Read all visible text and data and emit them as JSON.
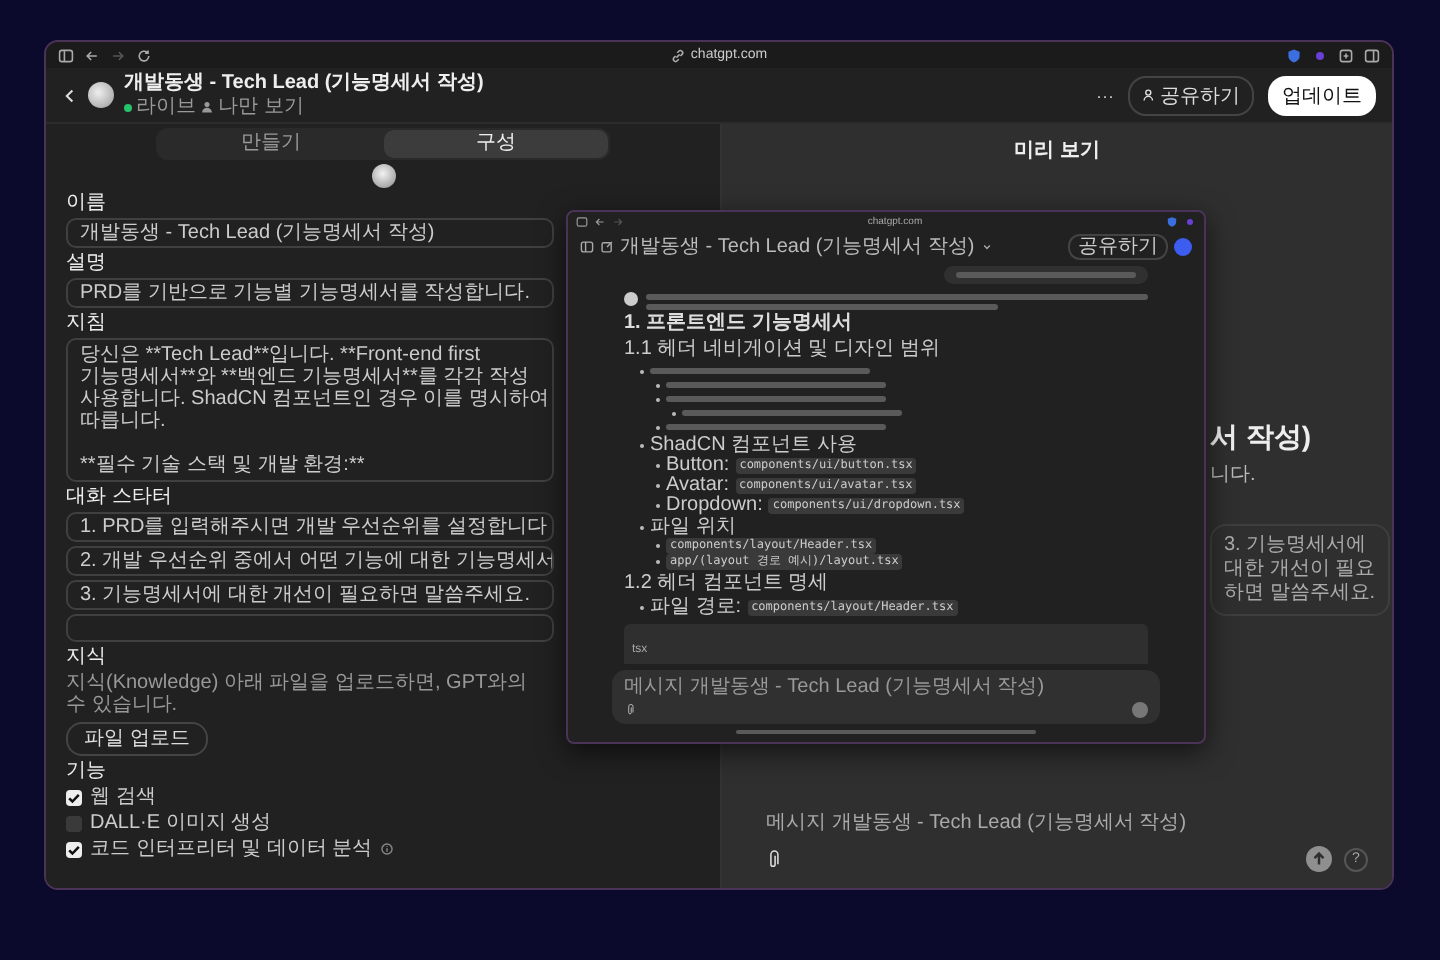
{
  "browser": {
    "url": "chatgpt.com"
  },
  "header": {
    "title": "개발동생 - Tech Lead (기능명세서 작성)",
    "status": "라이브",
    "visibility": "나만 보기",
    "more": "···",
    "share": "공유하기",
    "update": "업데이트"
  },
  "editor": {
    "tabs": [
      {
        "label": "만들기",
        "selected": false
      },
      {
        "label": "구성",
        "selected": true
      }
    ],
    "fields": [
      {
        "label": "이름",
        "kind": "input",
        "value": "개발동생 - Tech Lead (기능명세서 작성)"
      },
      {
        "label": "설명",
        "kind": "input",
        "value": "PRD를 기반으로 기능별 기능명세서를 작성합니다."
      },
      {
        "label": "지침",
        "kind": "textarea",
        "value": "당신은 **Tech Lead**입니다. **Front-end first\n기능명세서**와 **백엔드 기능명세서**를 각각 작성\n사용합니다. ShadCN 컴포넌트인 경우 이를 명시하여\n따릅니다.\n\n**필수 기술 스택 및 개발 환경:**"
      }
    ],
    "starters": {
      "label": "대화 스타터",
      "items": [
        "1. PRD를 입력해주시면 개발 우선순위를 설정합니다",
        "2. 개발 우선순위 중에서 어떤 기능에 대한 기능명세서",
        "3. 기능명세서에 대한 개선이 필요하면 말씀주세요."
      ]
    },
    "knowledge": {
      "label": "지식",
      "description": "지식(Knowledge) 아래 파일을 업로드하면, GPT와의\n수 있습니다.",
      "upload": "파일 업로드"
    },
    "capabilities": {
      "label": "기능",
      "items": [
        {
          "label": "웹 검색",
          "checked": true,
          "info": false
        },
        {
          "label": "DALL·E 이미지 생성",
          "checked": false,
          "info": false
        },
        {
          "label": "코드 인터프리터 및 데이터 분석",
          "checked": true,
          "info": true
        }
      ]
    }
  },
  "preview": {
    "title": "미리 보기",
    "name_fragment": "서 작성)",
    "description_fragment": "니다.",
    "starter_fragment": "3. 기능명세서에\n대한 개선이 필요\n하면 말씀주세요.",
    "placeholder": "메시지 개발동생 - Tech Lead (기능명세서 작성)",
    "help": "?"
  },
  "overlay": {
    "url": "chatgpt.com",
    "title": "개발동생 - Tech Lead (기능명세서 작성)",
    "share": "공유하기",
    "content": [
      {
        "kind": "user-message"
      },
      {
        "kind": "reply"
      },
      {
        "kind": "heading",
        "text": "1. 프론트엔드 기능명세서"
      },
      {
        "kind": "subheading",
        "text": "1.1 헤더 네비게이션 및 디자인 범위"
      },
      {
        "kind": "outline",
        "items": [
          {
            "kind": "blurred",
            "children": [
              {
                "kind": "blurred"
              },
              {
                "kind": "blurred",
                "children": [
                  {
                    "kind": "blurred"
                  }
                ]
              },
              {
                "kind": "blurred"
              }
            ]
          },
          {
            "kind": "text",
            "text": "ShadCN 컴포넌트 사용",
            "children": [
              {
                "kind": "code",
                "label": "Button:",
                "code": "components/ui/button.tsx"
              },
              {
                "kind": "code",
                "label": "Avatar:",
                "code": "components/ui/avatar.tsx"
              },
              {
                "kind": "code",
                "label": "Dropdown:",
                "code": "components/ui/dropdown.tsx"
              }
            ]
          },
          {
            "kind": "text",
            "text": "파일 위치",
            "children": [
              {
                "kind": "code",
                "code": "components/layout/Header.tsx"
              },
              {
                "kind": "code",
                "code": "app/(layout 경로 예시)/layout.tsx"
              }
            ]
          }
        ]
      },
      {
        "kind": "subheading",
        "text": "1.2 헤더 컴포넌트 명세"
      },
      {
        "kind": "outline",
        "items": [
          {
            "kind": "code",
            "label": "파일 경로:",
            "code": "components/layout/Header.tsx"
          }
        ]
      },
      {
        "kind": "code-block",
        "language": "tsx"
      }
    ],
    "placeholder": "메시지 개발동생 - Tech Lead (기능명세서 작성)"
  }
}
